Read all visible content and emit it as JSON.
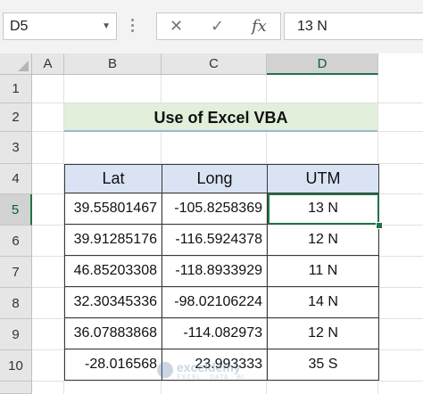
{
  "formula_bar": {
    "name_box": "D5",
    "cancel_icon": "✕",
    "enter_icon": "✓",
    "fx_icon": "fx",
    "value": "13 N"
  },
  "columns": [
    "A",
    "B",
    "C",
    "D"
  ],
  "selected_column": "D",
  "rows": [
    "1",
    "2",
    "3",
    "4",
    "5",
    "6",
    "7",
    "8",
    "9",
    "10"
  ],
  "selected_row": "5",
  "title": "Use of Excel VBA",
  "table": {
    "headers": [
      "Lat",
      "Long",
      "UTM"
    ],
    "rows": [
      [
        "39.55801467",
        "-105.8258369",
        "13 N"
      ],
      [
        "39.91285176",
        "-116.5924378",
        "12 N"
      ],
      [
        "46.85203308",
        "-118.8933929",
        "11 N"
      ],
      [
        "32.30345336",
        "-98.02106224",
        "14 N"
      ],
      [
        "36.07883868",
        "-114.082973",
        "12 N"
      ],
      [
        "-28.016568",
        "23.993333",
        "35 S"
      ]
    ]
  },
  "watermark": {
    "name": "exceldemy",
    "tagline": "EXCEL · DATA · BI"
  }
}
